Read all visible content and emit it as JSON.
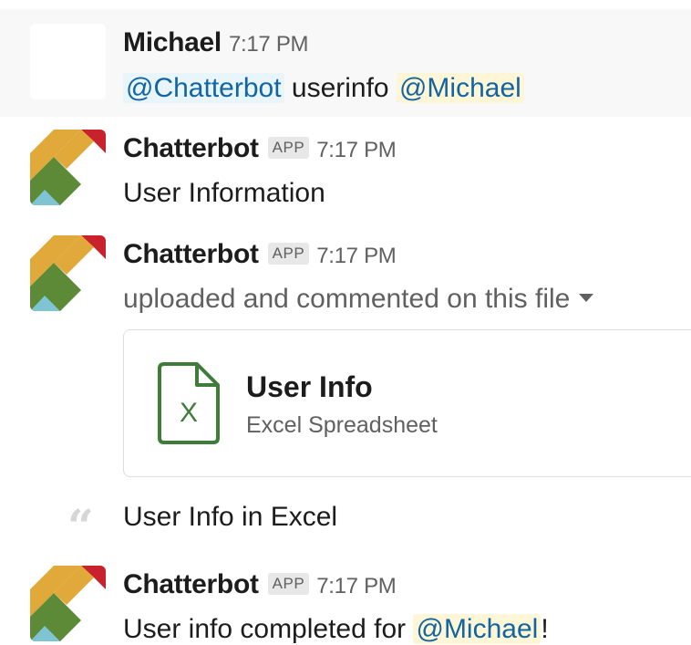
{
  "colors": {
    "link": "#1264a3",
    "mention_bg": "#e8f5fa",
    "self_mention_bg": "#fef6d7",
    "excel_green": "#3e7c3a",
    "avatar_red": "#c8232c",
    "avatar_yellow": "#e0a93a",
    "avatar_green": "#5d8a36",
    "avatar_teal": "#7ec4d3"
  },
  "messages": [
    {
      "author": "Michael",
      "time": "7:17 PM",
      "mention_bot": "@Chatterbot",
      "command": "userinfo",
      "mention_user": "@Michael"
    },
    {
      "author": "Chatterbot",
      "badge": "APP",
      "time": "7:17 PM",
      "text": "User Information"
    },
    {
      "author": "Chatterbot",
      "badge": "APP",
      "time": "7:17 PM",
      "text": "uploaded and commented on this file",
      "file": {
        "icon": "excel-file-icon",
        "icon_letter": "X",
        "title": "User Info",
        "subtitle": "Excel Spreadsheet"
      },
      "comment": "User Info in Excel"
    },
    {
      "author": "Chatterbot",
      "badge": "APP",
      "time": "7:17 PM",
      "text_prefix": "User info completed for ",
      "mention_user": "@Michael",
      "text_suffix": "!"
    }
  ]
}
